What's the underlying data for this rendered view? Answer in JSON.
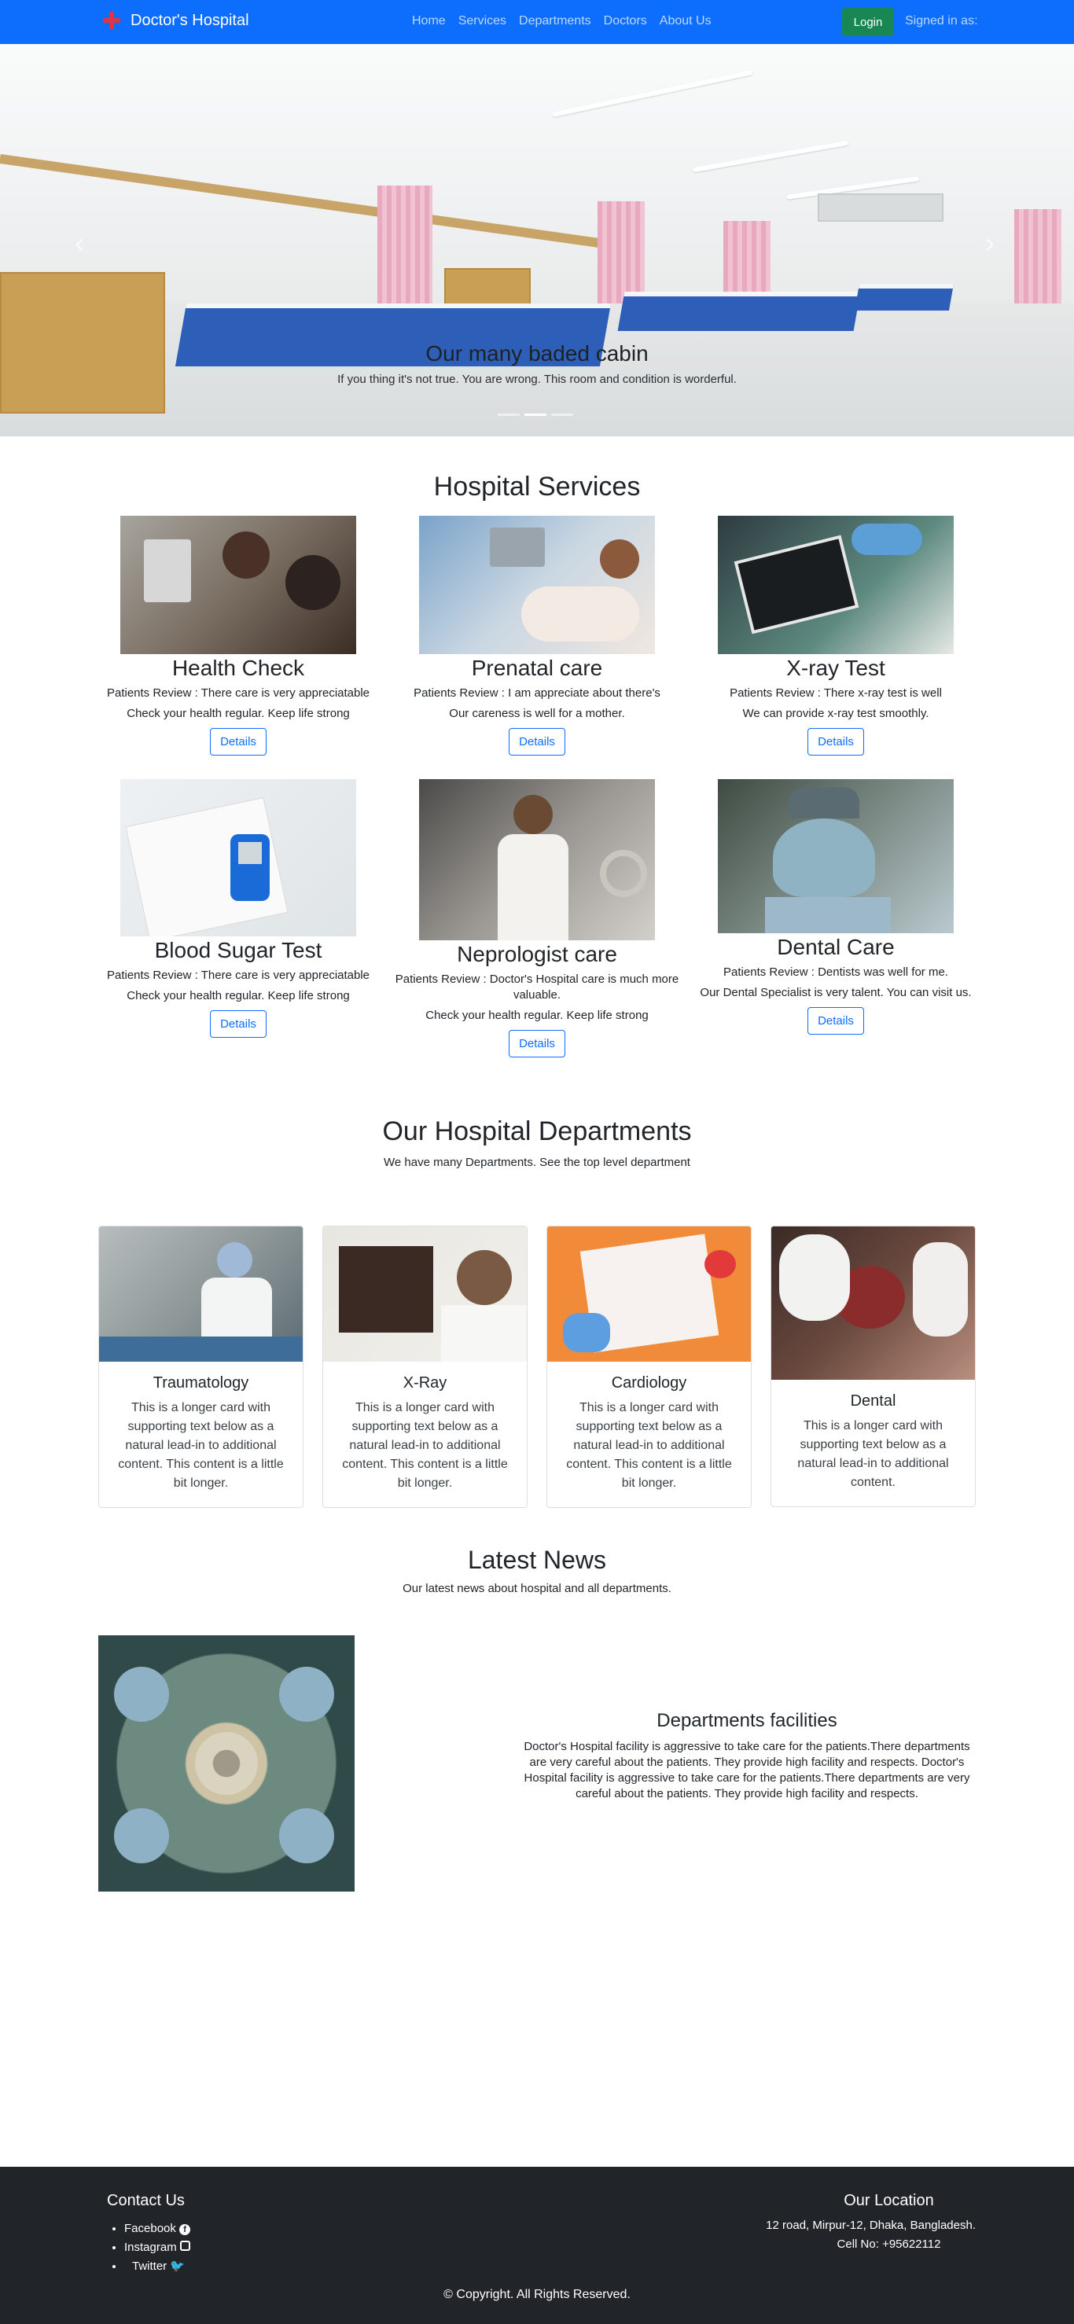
{
  "navbar": {
    "brand": "Doctor's Hospital",
    "links": [
      "Home",
      "Services",
      "Departments",
      "Doctors",
      "About Us"
    ],
    "login": "Login",
    "signed_in": "Signed in as:"
  },
  "hero": {
    "title": "Our many baded cabin",
    "text": "If you thing it's not true. You are wrong. This room and condition is worderful."
  },
  "services": {
    "title": "Hospital Services",
    "cards": [
      {
        "title": "Health Check",
        "review": "Patients Review : There care is very appreciatable",
        "text": "Check your health regular. Keep life strong",
        "button": "Details"
      },
      {
        "title": "Prenatal care",
        "review": "Patients Review : I am appreciate about there's",
        "text": "Our careness is well for a mother.",
        "button": "Details"
      },
      {
        "title": "X-ray Test",
        "review": "Patients Review : There x-ray test is well",
        "text": "We can provide x-ray test smoothly.",
        "button": "Details"
      },
      {
        "title": "Blood Sugar Test",
        "review": "Patients Review : There care is very appreciatable",
        "text": "Check your health regular. Keep life strong",
        "button": "Details"
      },
      {
        "title": "Neprologist care",
        "review": "Patients Review : Doctor's Hospital care is much more valuable.",
        "text": "Check your health regular. Keep life strong",
        "button": "Details"
      },
      {
        "title": "Dental Care",
        "review": "Patients Review : Dentists was well for me.",
        "text": "Our Dental Specialist is very talent. You can visit us.",
        "button": "Details"
      }
    ]
  },
  "departments": {
    "title": "Our Hospital Departments",
    "subtitle": "We have many Departments. See the top level department",
    "cards": [
      {
        "title": "Traumatology",
        "text": "This is a longer card with supporting text below as a natural lead-in to additional content. This content is a little bit longer."
      },
      {
        "title": "X-Ray",
        "text": "This is a longer card with supporting text below as a natural lead-in to additional content. This content is a little bit longer."
      },
      {
        "title": "Cardiology",
        "text": "This is a longer card with supporting text below as a natural lead-in to additional content. This content is a little bit longer."
      },
      {
        "title": "Dental",
        "text": "This is a longer card with supporting text below as a natural lead-in to additional content."
      }
    ]
  },
  "news": {
    "title": "Latest News",
    "subtitle": "Our latest news about hospital and all departments.",
    "article_title": "Departments facilities",
    "article_text": "Doctor's Hospital facility is aggressive to take care for the patients.There departments are very careful about the patients. They provide high facility and respects. Doctor's Hospital facility is aggressive to take care for the patients.There departments are very careful about the patients. They provide high facility and respects."
  },
  "footer": {
    "contact_title": "Contact Us",
    "contacts": [
      "Facebook",
      "Instagram",
      "Twitter"
    ],
    "location_title": "Our Location",
    "address": "12 road, Mirpur-12, Dhaka, Bangladesh.",
    "phone": "Cell No: +95622112",
    "copyright": "Copyright. All Rights Reserved."
  },
  "colors": {
    "primary": "#0d6efd",
    "success": "#198754",
    "footer": "#212529",
    "brand_icon": "#dc3545"
  }
}
